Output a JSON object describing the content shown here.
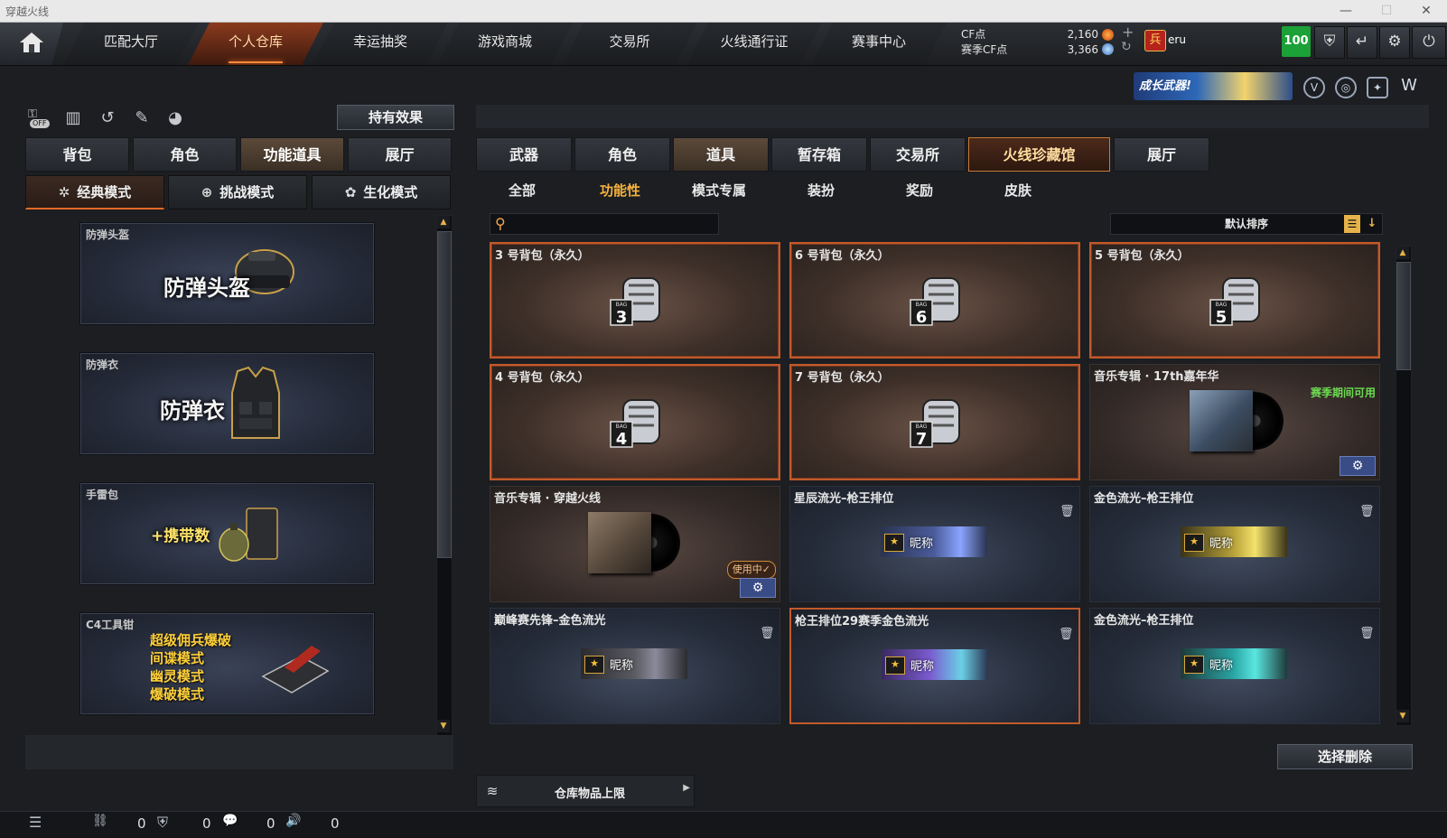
{
  "window": {
    "title": "穿越火线",
    "controls": [
      "—",
      "☐",
      "✕"
    ]
  },
  "nav": {
    "tabs": [
      "匹配大厅",
      "个人仓库",
      "幸运抽奖",
      "游戏商城",
      "交易所",
      "火线通行证",
      "赛事中心"
    ],
    "active_index": 1
  },
  "currency": {
    "cf_label": "CF点",
    "cf_value": "2,160",
    "season_label": "赛季CF点",
    "season_value": "3,366"
  },
  "rank": {
    "label": "eru",
    "badge": "兵"
  },
  "top_right": {
    "level": "100"
  },
  "growth_banner": "成长武器!",
  "left": {
    "hold_effect_btn": "持有效果",
    "off_label": "OFF",
    "tabs": [
      "背包",
      "角色",
      "功能道具",
      "展厅"
    ],
    "active_tab": 2,
    "modes": [
      "经典模式",
      "挑战模式",
      "生化模式"
    ],
    "active_mode": 0,
    "cards": [
      {
        "caption": "防弹头盔",
        "big": "防弹头盔"
      },
      {
        "caption": "防弹衣",
        "big": "防弹衣"
      },
      {
        "caption": "手雷包",
        "big": "+携带数"
      },
      {
        "caption": "C4工具钳",
        "lines": [
          "超级佣兵爆破",
          "间谍模式",
          "幽灵模式",
          "爆破模式"
        ]
      }
    ]
  },
  "right": {
    "tabs": [
      "武器",
      "角色",
      "道具",
      "暂存箱",
      "交易所",
      "火线珍藏馆",
      "展厅"
    ],
    "active_tab": 2,
    "special_tab": 5,
    "subtabs": [
      "全部",
      "功能性",
      "模式专属",
      "装扮",
      "奖励",
      "皮肤"
    ],
    "active_subtab": 1,
    "search_placeholder": "",
    "sort_label": "默认排序",
    "items": [
      {
        "title": "3 号背包（永久）",
        "bag": "3"
      },
      {
        "title": "6 号背包（永久）",
        "bag": "6"
      },
      {
        "title": "5 号背包（永久）",
        "bag": "5"
      },
      {
        "title": "4 号背包（永久）",
        "bag": "4"
      },
      {
        "title": "7 号背包（永久）",
        "bag": "7"
      },
      {
        "title": "音乐专辑 · 17th嘉年华",
        "season": "赛季期间可用"
      },
      {
        "title": "音乐专辑 · 穿越火线",
        "inuse": "使用中✓"
      },
      {
        "title": "星辰流光–枪王排位",
        "nick": "昵称"
      },
      {
        "title": "金色流光–枪王排位",
        "nick": "昵称"
      },
      {
        "title": "巅峰赛先锋–金色流光",
        "nick": "昵称"
      },
      {
        "title": "枪王排位29赛季金色流光",
        "nick": "昵称"
      },
      {
        "title": "金色流光–枪王排位",
        "nick": "昵称"
      }
    ],
    "select_delete_btn": "选择删除",
    "warehouse_limit": "仓库物品上限"
  },
  "bottom": {
    "counts": [
      "0",
      "0",
      "0",
      "0"
    ]
  }
}
